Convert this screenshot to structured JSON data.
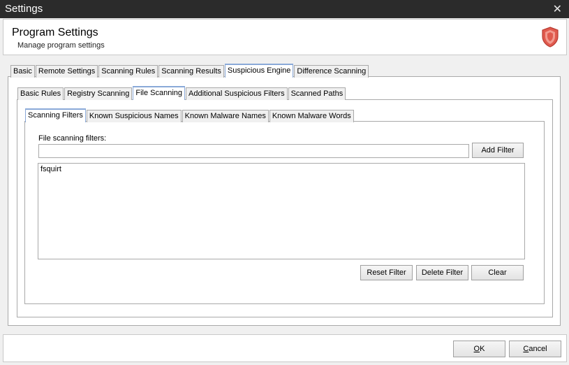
{
  "window": {
    "title": "Settings",
    "close_glyph": "✕"
  },
  "header": {
    "title": "Program Settings",
    "subtitle": "Manage program settings",
    "icon": "shield-icon",
    "accent_color": "#d9534f"
  },
  "main_tabs": [
    {
      "label": "Basic",
      "active": false
    },
    {
      "label": "Remote Settings",
      "active": false
    },
    {
      "label": "Scanning Rules",
      "active": false
    },
    {
      "label": "Scanning Results",
      "active": false
    },
    {
      "label": "Suspicious Engine",
      "active": true
    },
    {
      "label": "Difference Scanning",
      "active": false
    }
  ],
  "engine_tabs": [
    {
      "label": "Basic Rules",
      "active": false
    },
    {
      "label": "Registry Scanning",
      "active": false
    },
    {
      "label": "File Scanning",
      "active": true
    },
    {
      "label": "Additional Suspicious Filters",
      "active": false
    },
    {
      "label": "Scanned Paths",
      "active": false
    }
  ],
  "file_tabs": [
    {
      "label": "Scanning Filters",
      "active": true
    },
    {
      "label": "Known Suspicious Names",
      "active": false
    },
    {
      "label": "Known Malware Names",
      "active": false
    },
    {
      "label": "Known Malware Words",
      "active": false
    }
  ],
  "filters": {
    "label": "File scanning filters:",
    "input_value": "",
    "add_label": "Add Filter",
    "items": [
      "fsquirt"
    ],
    "reset_label": "Reset Filter",
    "delete_label": "Delete Filter",
    "clear_label": "Clear"
  },
  "footer": {
    "ok_label": "OK",
    "cancel_label": "Cancel"
  }
}
